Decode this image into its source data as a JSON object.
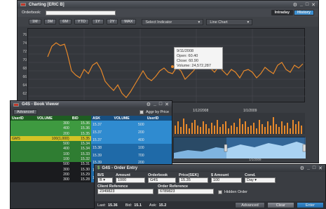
{
  "chart_window": {
    "title": "Charting [ERIC B]",
    "orderbook_label": "Orderbook:",
    "tabs": [
      "Intraday",
      "History"
    ],
    "periods": [
      "1M",
      "3M",
      "6M",
      "YTD",
      "1Y",
      "2Y",
      "MAX"
    ],
    "indicator_select": "Select Indicator",
    "chart_type_select": "Line Chart",
    "y_ticks": [
      "76",
      "74",
      "72",
      "70",
      "68",
      "66",
      "64",
      "62"
    ],
    "x_ticks": [
      "1/12/2008",
      "1/1/2009"
    ],
    "tooltip": {
      "date": "9/11/2008",
      "open": "Open: 60.40",
      "close": "Close: 60.90",
      "volume": "Volume: 24,572,287"
    },
    "volume_axis_date": "1/1/2009"
  },
  "book_window": {
    "title": "G4S - Book Viewer",
    "advanced_label": "Advanced",
    "aggr_label": "Aggr by Price",
    "bid_headers": [
      "UserID",
      "VOLUME",
      "BID"
    ],
    "ask_headers": [
      "ASK",
      "VOLUME",
      "UserID"
    ],
    "bid_rows": [
      [
        "",
        "300",
        "15.36"
      ],
      [
        "",
        "400",
        "15.36"
      ],
      [
        "",
        "200",
        "15.35"
      ],
      [
        "GMS",
        "100(1,000)",
        "15.35"
      ],
      [
        "",
        "500",
        "15.34"
      ],
      [
        "",
        "400",
        "15.34"
      ],
      [
        "",
        "100",
        "15.33"
      ],
      [
        "",
        "100",
        "15.32"
      ],
      [
        "",
        "500",
        "15.31"
      ],
      [
        "",
        "300",
        "15.30"
      ],
      [
        "",
        "200",
        "15.29"
      ],
      [
        "",
        "300",
        "15.28"
      ]
    ],
    "ask_rows": [
      [
        "15.37",
        "500",
        ""
      ],
      [
        "15.37",
        "200",
        ""
      ],
      [
        "15.37",
        "400",
        ""
      ],
      [
        "15.38",
        "100",
        ""
      ],
      [
        "15.39",
        "700",
        ""
      ],
      [
        "15.39",
        "200",
        ""
      ],
      [
        "15.40",
        "100",
        ""
      ],
      [
        "15.41",
        "300",
        ""
      ]
    ]
  },
  "order_window": {
    "title": "G4S - Order Entry",
    "bs_label": "B/S",
    "bs_value": "B",
    "amount_label": "Amount",
    "amount_value": "1000",
    "orderbook_label": "Orderbook",
    "orderbook_value": "G4S",
    "price_label": "Price(SEK)",
    "price_value": "15.35",
    "smount_label": "$ Amount",
    "smount_value": "100",
    "cond_label": "Cond.",
    "cond_value": "Day",
    "client_ref_label": "Client Reference",
    "client_ref_value": "2349823",
    "order_ref_label": "Order Reference",
    "order_ref_value": "6789823",
    "hidden_label": "Hidden Order",
    "last_label": "Last:",
    "last_value": "15.36",
    "bid_label": "Bid:",
    "bid_value": "15.1",
    "ask_label": "Ask:",
    "ask_value": "15.2",
    "advanced_btn": "Advanced",
    "clear_btn": "Clear",
    "enter_btn": "Enter"
  },
  "colors": {
    "line": "#e8892a",
    "bid_green": "#2f7d32",
    "bid_light": "#3e9a40",
    "bid_highlight": "#d4c325",
    "ask_blue": "#1f6aa8",
    "ask_light": "#2f8bd0"
  }
}
